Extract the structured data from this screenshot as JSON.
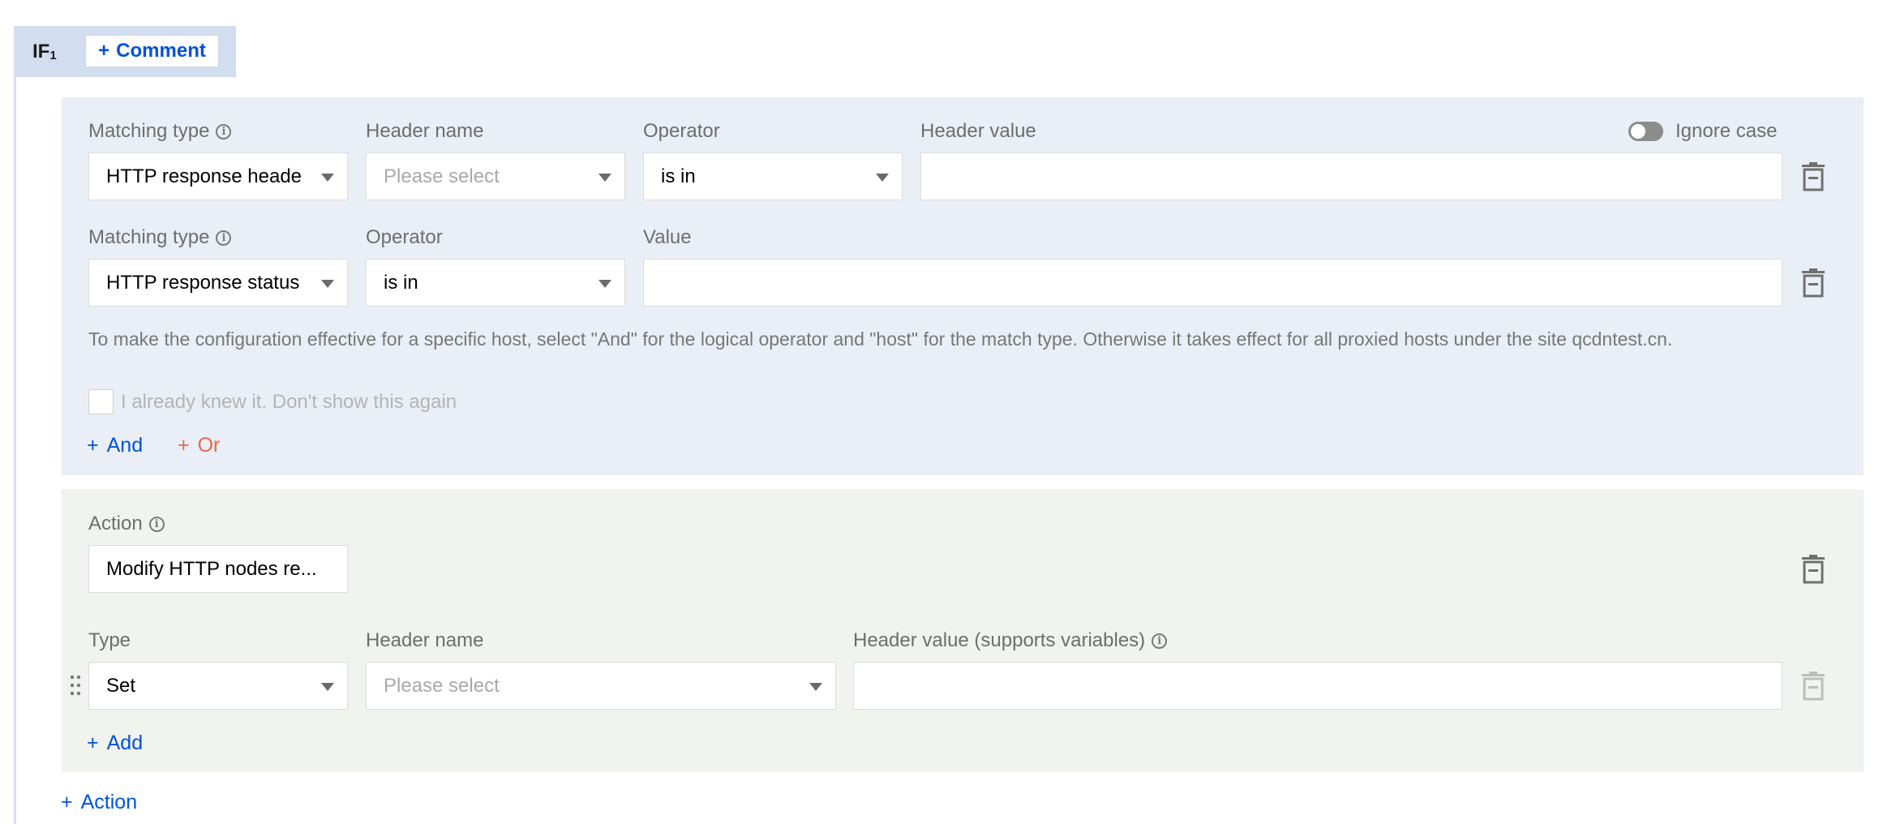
{
  "header": {
    "if_label": "IF",
    "if_index": "1",
    "comment_label": "Comment"
  },
  "conditions": {
    "row1": {
      "matching_type_label": "Matching type",
      "matching_type_value": "HTTP response heade",
      "header_name_label": "Header name",
      "header_name_placeholder": "Please select",
      "operator_label": "Operator",
      "operator_value": "is in",
      "header_value_label": "Header value",
      "header_value": "",
      "ignore_case_label": "Ignore case"
    },
    "row2": {
      "matching_type_label": "Matching type",
      "matching_type_value": "HTTP response status",
      "operator_label": "Operator",
      "operator_value": "is in",
      "value_label": "Value",
      "value": ""
    },
    "note": "To make the configuration effective for a specific host, select \"And\" for the logical operator and \"host\" for the match type. Otherwise it takes effect for all proxied hosts under the site qcdntest.cn.",
    "dont_show_label": "I already knew it. Don't show this again",
    "and_label": "And",
    "or_label": "Or"
  },
  "action": {
    "action_label": "Action",
    "action_value": "Modify HTTP nodes re...",
    "type_label": "Type",
    "type_value": "Set",
    "header_name_label": "Header name",
    "header_name_placeholder": "Please select",
    "header_value_label": "Header value (supports variables)",
    "header_value": "",
    "add_label": "Add"
  },
  "footer": {
    "add_action_label": "Action"
  },
  "colors": {
    "accent": "#0052d9",
    "or_accent": "#e36a49",
    "condition_panel": "#eaeef6",
    "action_panel": "#f1f3ee"
  }
}
